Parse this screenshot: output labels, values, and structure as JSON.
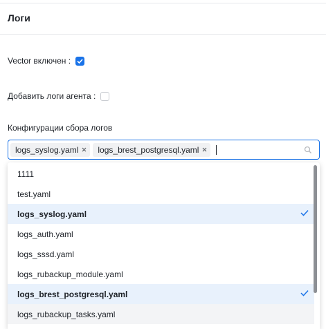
{
  "panel": {
    "title": "Логи"
  },
  "fields": {
    "vector_label": "Vector включен :",
    "vector_enabled": true,
    "agent_logs_label": "Добавить логи агента :",
    "agent_logs_enabled": false,
    "config_label": "Конфигурации сбора логов"
  },
  "select": {
    "tags": [
      {
        "label": "logs_syslog.yaml"
      },
      {
        "label": "logs_brest_postgresql.yaml"
      }
    ],
    "icon": "search-icon"
  },
  "dropdown": {
    "options": [
      {
        "label": "1111",
        "selected": false
      },
      {
        "label": "test.yaml",
        "selected": false
      },
      {
        "label": "logs_syslog.yaml",
        "selected": true
      },
      {
        "label": "logs_auth.yaml",
        "selected": false
      },
      {
        "label": "logs_sssd.yaml",
        "selected": false
      },
      {
        "label": "logs_rubackup_module.yaml",
        "selected": false
      },
      {
        "label": "logs_brest_postgresql.yaml",
        "selected": true
      },
      {
        "label": "logs_rubackup_tasks.yaml",
        "selected": false
      }
    ]
  },
  "colors": {
    "accent": "#1a73e8",
    "selected_bg": "#e8f1fc",
    "text": "#1f2329"
  }
}
